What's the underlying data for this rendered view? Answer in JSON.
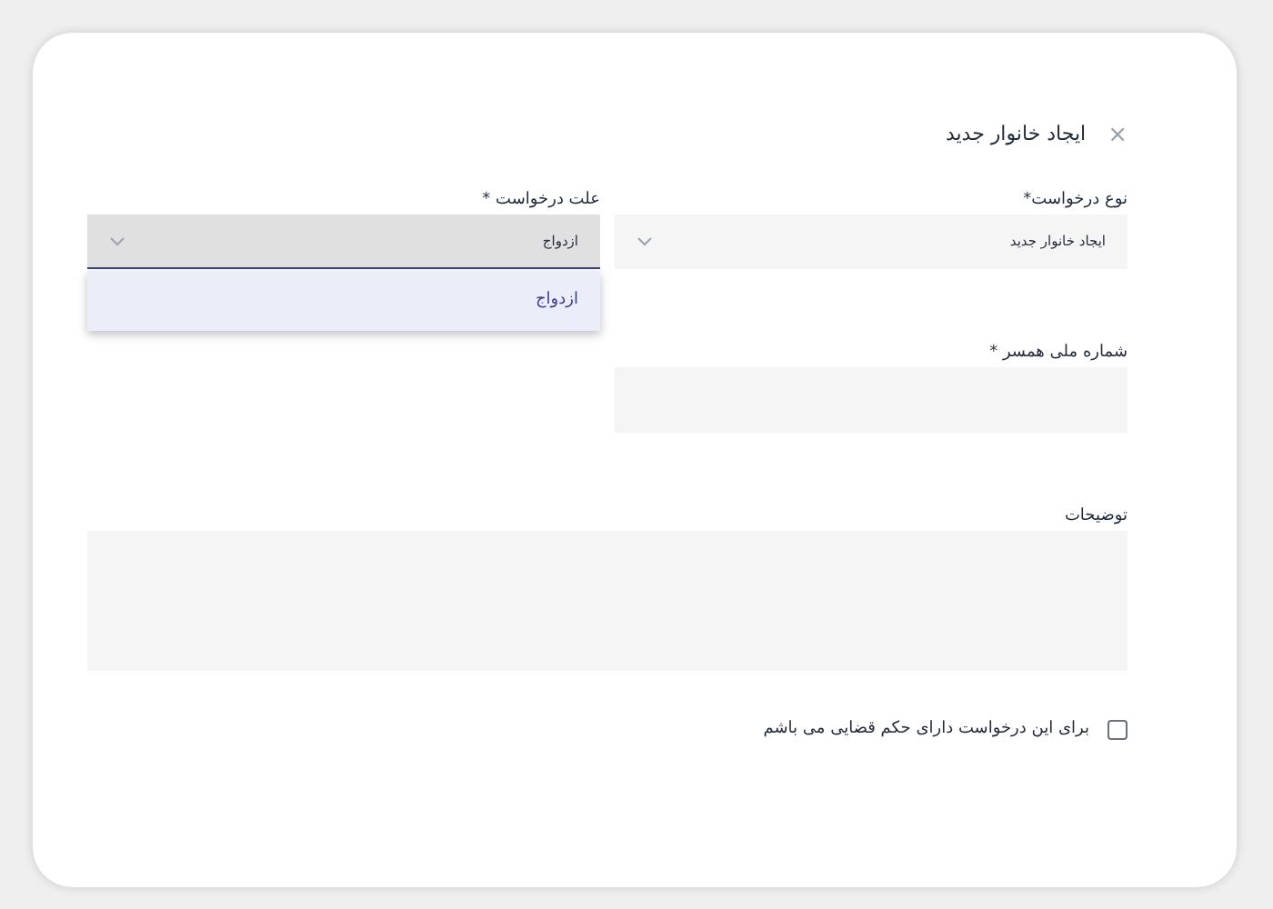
{
  "dialog": {
    "title": "ایجاد خانوار جدید",
    "close": "×"
  },
  "fields": [
    {
      "kind": "select",
      "label": "نوع درخواست*",
      "value": "ایجاد خانوار جدید",
      "expanded": false
    },
    {
      "kind": "select",
      "label": "علت درخواست *",
      "value": "ازدواج",
      "expanded": true,
      "options": [
        {
          "label": "ازدواج",
          "selected": true
        }
      ]
    },
    {
      "kind": "text",
      "label": "شماره ملی همسر *"
    },
    {
      "kind": "textarea",
      "label": "توضیحات"
    }
  ],
  "checkbox": {
    "label": "برای این درخواست دارای حکم قضایی می باشم",
    "checked": false
  }
}
